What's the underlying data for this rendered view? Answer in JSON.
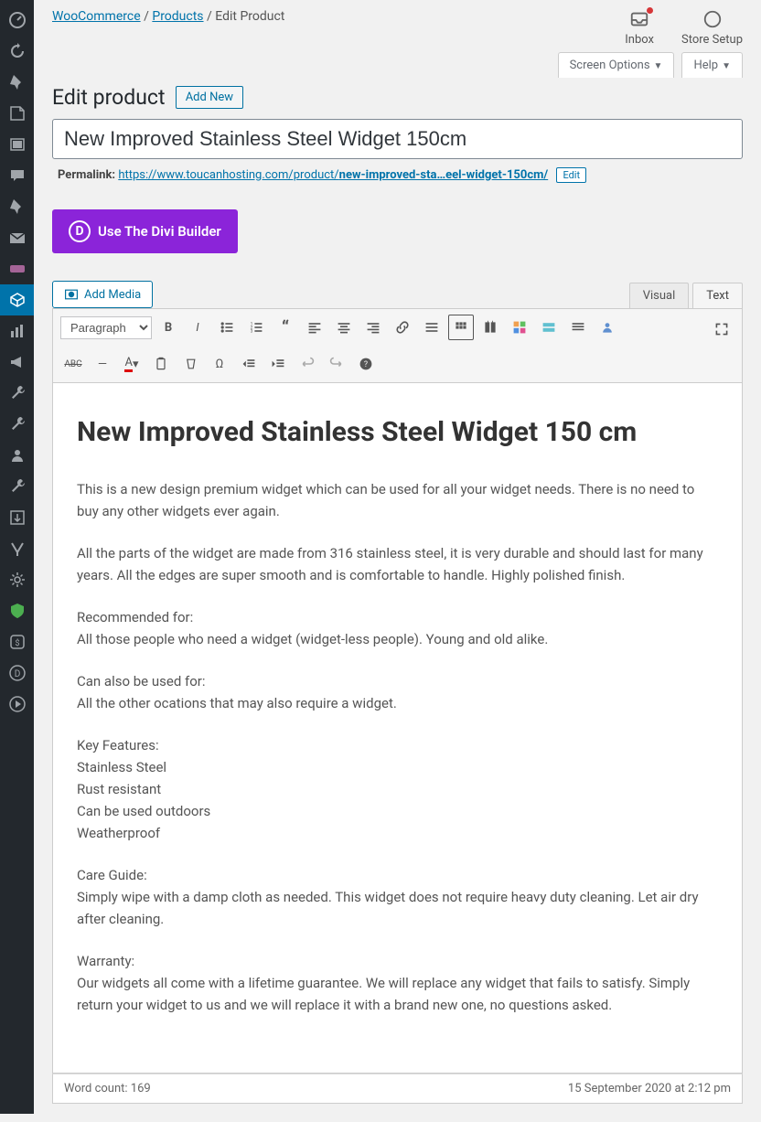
{
  "breadcrumb": {
    "woo": "WooCommerce",
    "products": "Products",
    "current": "Edit Product"
  },
  "topright": {
    "inbox": "Inbox",
    "storesetup": "Store Setup"
  },
  "subtabs": {
    "screen": "Screen Options",
    "help": "Help"
  },
  "page": {
    "title": "Edit product",
    "add_new": "Add New"
  },
  "titleinput": {
    "value": "New Improved Stainless Steel Widget 150cm"
  },
  "permalink": {
    "label": "Permalink: ",
    "base": "https://www.toucanhosting.com/product/",
    "slug": "new-improved-sta…eel-widget-150cm/",
    "edit": "Edit"
  },
  "divi": {
    "label": "Use The Divi Builder"
  },
  "media": {
    "add": "Add Media"
  },
  "editor": {
    "visual": "Visual",
    "text": "Text",
    "format": "Paragraph"
  },
  "content": {
    "heading": "New Improved Stainless Steel Widget 150 cm",
    "p1": "This is a new design premium widget which can be used for all your widget needs. There is no need to buy any other widgets ever again.",
    "p2": "All the parts of the widget are made from 316 stainless steel, it is very durable and should last for many years. All the edges are super smooth and is comfortable to handle. Highly polished finish.",
    "p3a": "Recommended for:",
    "p3b": "All those people who need a widget (widget-less people). Young and old alike.",
    "p4a": "Can also be used for:",
    "p4b": "All the other ocations that may also require a widget.",
    "p5a": "Key Features:",
    "p5b": "Stainless Steel",
    "p5c": "Rust resistant",
    "p5d": "Can be used outdoors",
    "p5e": "Weatherproof",
    "p6a": "Care Guide:",
    "p6b": "Simply wipe with a damp cloth as needed. This widget does not require heavy duty cleaning. Let air dry after cleaning.",
    "p7a": "Warranty:",
    "p7b": "Our widgets all come with a lifetime guarantee. We will replace any widget that fails to satisfy. Simply return your widget to us and we will replace it with a brand new one, no questions asked."
  },
  "statusbar": {
    "wordcount": "Word count: 169",
    "modified": "15 September 2020 at 2:12 pm"
  }
}
